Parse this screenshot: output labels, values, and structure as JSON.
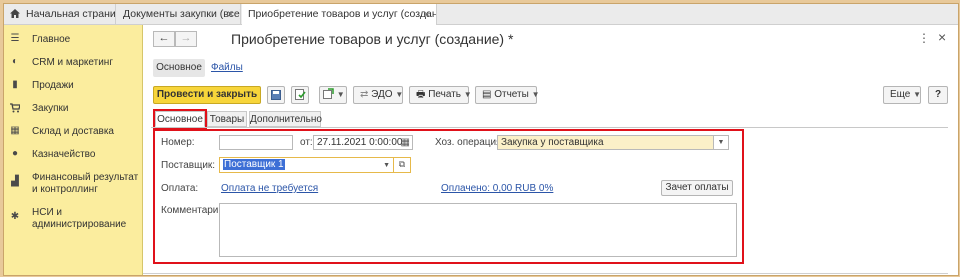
{
  "tabs": [
    {
      "label": "Начальная страница",
      "icon": "home-icon"
    },
    {
      "label": "Документы закупки (все)",
      "close": "×"
    },
    {
      "label": "Приобретение товаров и услуг (создание) *",
      "close": "×"
    }
  ],
  "sidebar": {
    "items": [
      {
        "label": "Главное",
        "icon": "menu-icon",
        "glyph": "☰"
      },
      {
        "label": "CRM и маркетинг",
        "icon": "crm-icon",
        "glyph": "◐"
      },
      {
        "label": "Продажи",
        "icon": "sales-bag-icon",
        "glyph": "▮"
      },
      {
        "label": "Закупки",
        "icon": "cart-icon",
        "glyph": "🛒"
      },
      {
        "label": "Склад и доставка",
        "icon": "warehouse-icon",
        "glyph": "▦"
      },
      {
        "label": "Казначейство",
        "icon": "treasury-icon",
        "glyph": "●"
      },
      {
        "label": "Финансовый результат и контроллинг",
        "icon": "chart-icon",
        "glyph": "▟"
      },
      {
        "label": "НСИ и администрирование",
        "icon": "settings-gear-icon",
        "glyph": "✱"
      }
    ]
  },
  "header": {
    "back": "←",
    "forward": "→",
    "title": "Приобретение товаров и услуг (создание) *",
    "more": "⋮",
    "close": "×"
  },
  "subtabs": {
    "main": "Основное",
    "files": "Файлы"
  },
  "toolbar": {
    "post_close": "Провести и закрыть",
    "edo": "ЭДО",
    "print": "Печать",
    "reports": "Отчеты",
    "more": "Еще",
    "help": "?"
  },
  "form_tabs": [
    "Основное",
    "Товары",
    "Дополнительно"
  ],
  "form": {
    "number_label": "Номер:",
    "number_value": "",
    "date_label": "от:",
    "date_value": "27.11.2021  0:00:00",
    "operation_label": "Хоз. операция:",
    "operation_value": "Закупка у поставщика",
    "supplier_label": "Поставщик:",
    "supplier_value": "Поставщик 1",
    "payment_label": "Оплата:",
    "payment_link": "Оплата не требуется",
    "paid_link": "Оплачено: 0,00 RUB 0%",
    "offset_button": "Зачет оплаты",
    "comment_label": "Комментарий:",
    "comment_value": ""
  },
  "colors": {
    "accent": "#f7d53a",
    "highlight": "#e0111a",
    "link": "#2b55a8",
    "sidebar": "#fbed9e"
  }
}
